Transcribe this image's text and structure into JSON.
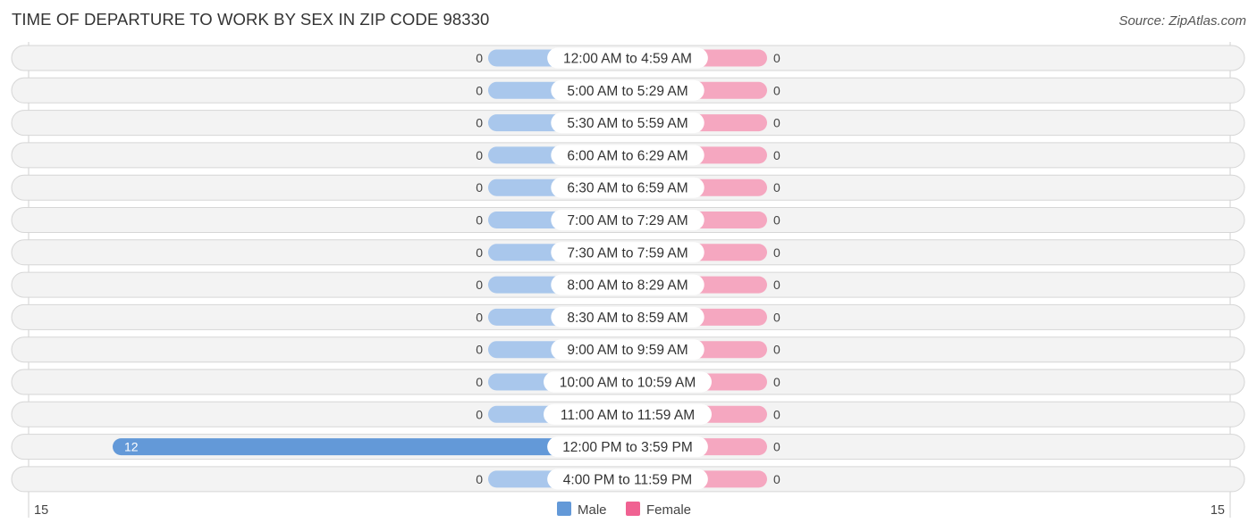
{
  "header": {
    "title": "TIME OF DEPARTURE TO WORK BY SEX IN ZIP CODE 98330",
    "source": "Source: ZipAtlas.com"
  },
  "colors": {
    "male": "#6399d8",
    "male_light": "#a9c7ec",
    "female": "#f06292",
    "female_light": "#f5a7c0"
  },
  "chart_data": {
    "type": "bar",
    "orientation": "horizontal-diverging",
    "title": "TIME OF DEPARTURE TO WORK BY SEX IN ZIP CODE 98330",
    "categories": [
      "12:00 AM to 4:59 AM",
      "5:00 AM to 5:29 AM",
      "5:30 AM to 5:59 AM",
      "6:00 AM to 6:29 AM",
      "6:30 AM to 6:59 AM",
      "7:00 AM to 7:29 AM",
      "7:30 AM to 7:59 AM",
      "8:00 AM to 8:29 AM",
      "8:30 AM to 8:59 AM",
      "9:00 AM to 9:59 AM",
      "10:00 AM to 10:59 AM",
      "11:00 AM to 11:59 AM",
      "12:00 PM to 3:59 PM",
      "4:00 PM to 11:59 PM"
    ],
    "series": [
      {
        "name": "Male",
        "values": [
          0,
          0,
          0,
          0,
          0,
          0,
          0,
          0,
          0,
          0,
          0,
          0,
          12,
          0
        ]
      },
      {
        "name": "Female",
        "values": [
          0,
          0,
          0,
          0,
          0,
          0,
          0,
          0,
          0,
          0,
          0,
          0,
          0,
          0
        ]
      }
    ],
    "xlim": [
      -15,
      15
    ],
    "axis_labels": {
      "left": "15",
      "right": "15"
    },
    "legend": {
      "position": "bottom-center",
      "entries": [
        "Male",
        "Female"
      ]
    },
    "grid": false
  }
}
